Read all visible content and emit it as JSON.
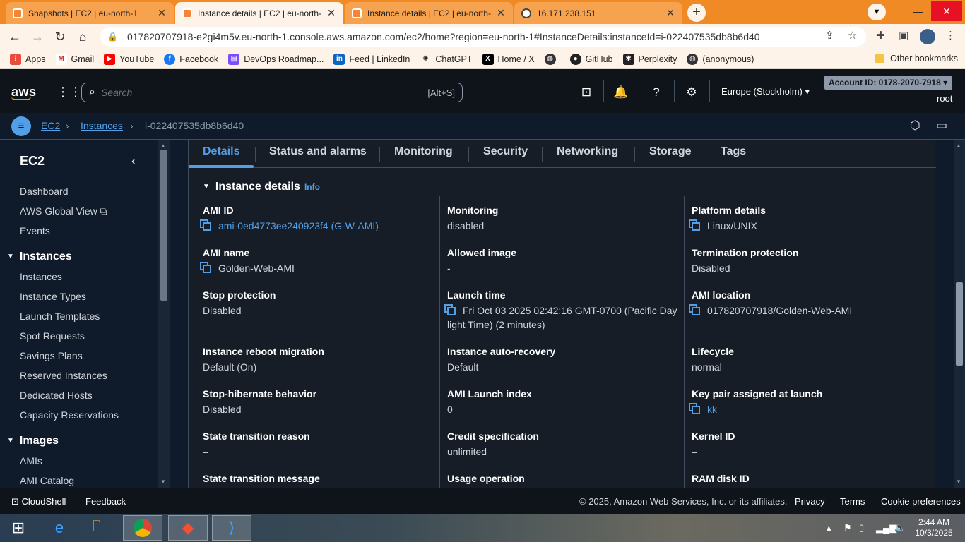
{
  "browser": {
    "tabs": [
      {
        "title": "Snapshots | EC2 | eu-north-1",
        "active": false,
        "icon": "aws-icon"
      },
      {
        "title": "Instance details | EC2 | eu-north-",
        "active": true,
        "icon": "aws-icon"
      },
      {
        "title": "Instance details | EC2 | eu-north-",
        "active": false,
        "icon": "aws-icon"
      },
      {
        "title": "16.171.238.151",
        "active": false,
        "icon": "globe-icon"
      }
    ],
    "url": "017820707918-e2gi4m5v.eu-north-1.console.aws.amazon.com/ec2/home?region=eu-north-1#InstanceDetails:instanceId=i-022407535db8b6d40",
    "bookmarks": [
      "Apps",
      "Gmail",
      "YouTube",
      "Facebook",
      "DevOps Roadmap...",
      "Feed | LinkedIn",
      "ChatGPT",
      "Home / X",
      "",
      "GitHub",
      "Perplexity",
      "(anonymous)"
    ],
    "other_bookmarks": "Other bookmarks"
  },
  "aws": {
    "logo": "aws",
    "search_placeholder": "Search",
    "search_shortcut": "[Alt+S]",
    "region": "Europe (Stockholm)",
    "account": "Account ID: 0178-2070-7918",
    "user": "root"
  },
  "breadcrumb": {
    "ec2": "EC2",
    "instances": "Instances",
    "current": "i-022407535db8b6d40"
  },
  "sidebar": {
    "title": "EC2",
    "top_items": [
      "Dashboard",
      "AWS Global View",
      "Events"
    ],
    "instances_header": "Instances",
    "instances_items": [
      "Instances",
      "Instance Types",
      "Launch Templates",
      "Spot Requests",
      "Savings Plans",
      "Reserved Instances",
      "Dedicated Hosts",
      "Capacity Reservations"
    ],
    "images_header": "Images",
    "images_items": [
      "AMIs",
      "AMI Catalog"
    ]
  },
  "detail_tabs": [
    "Details",
    "Status and alarms",
    "Monitoring",
    "Security",
    "Networking",
    "Storage",
    "Tags"
  ],
  "section": {
    "title": "Instance details",
    "info": "Info"
  },
  "fields": {
    "col1": [
      {
        "label": "AMI ID",
        "value": "ami-0ed4773ee240923f4 (G-W-AMI)"
      },
      {
        "label": "AMI name",
        "value": "Golden-Web-AMI"
      },
      {
        "label": "Stop protection",
        "value": "Disabled"
      },
      {
        "label": "Instance reboot migration",
        "value": "Default (On)"
      },
      {
        "label": "Stop-hibernate behavior",
        "value": "Disabled"
      },
      {
        "label": "State transition reason",
        "value": "–"
      },
      {
        "label": "State transition message",
        "value": ""
      }
    ],
    "col2": [
      {
        "label": "Monitoring",
        "value": "disabled"
      },
      {
        "label": "Allowed image",
        "value": "-"
      },
      {
        "label": "Launch time",
        "value": "Fri Oct 03 2025 02:42:16 GMT-0700 (Pacific Daylight Time) (2 minutes)"
      },
      {
        "label": "Instance auto-recovery",
        "value": "Default"
      },
      {
        "label": "AMI Launch index",
        "value": "0"
      },
      {
        "label": "Credit specification",
        "value": "unlimited"
      },
      {
        "label": "Usage operation",
        "value": ""
      }
    ],
    "col3": [
      {
        "label": "Platform details",
        "value": "Linux/UNIX"
      },
      {
        "label": "Termination protection",
        "value": "Disabled"
      },
      {
        "label": "AMI location",
        "value": "017820707918/Golden-Web-AMI"
      },
      {
        "label": "Lifecycle",
        "value": "normal"
      },
      {
        "label": "Key pair assigned at launch",
        "value": "kk"
      },
      {
        "label": "Kernel ID",
        "value": "–"
      },
      {
        "label": "RAM disk ID",
        "value": ""
      }
    ]
  },
  "footer": {
    "cloudshell": "CloudShell",
    "feedback": "Feedback",
    "copyright": "© 2025, Amazon Web Services, Inc. or its affiliates.",
    "privacy": "Privacy",
    "terms": "Terms",
    "cookies": "Cookie preferences"
  },
  "taskbar": {
    "time": "2:44 AM",
    "date": "10/3/2025"
  }
}
